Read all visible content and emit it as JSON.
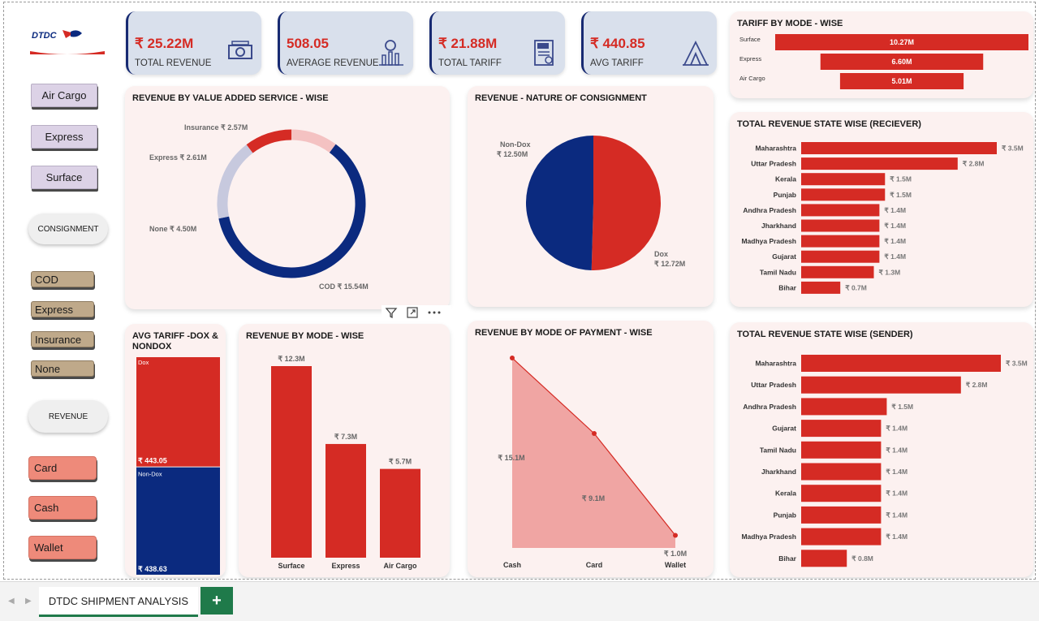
{
  "kpis": [
    {
      "value": "₹ 25.22M",
      "label": "TOTAL REVENUE",
      "icon": "money-icon"
    },
    {
      "value": "508.05",
      "label": "AVERAGE REVENUE",
      "icon": "growth-chart-icon"
    },
    {
      "value": "₹ 21.88M",
      "label": "TOTAL TARIFF",
      "icon": "tax-document-icon"
    },
    {
      "value": "₹ 440.85",
      "label": "AVG TARIFF",
      "icon": "tent-icon"
    }
  ],
  "logo": {
    "text": "DTDC"
  },
  "slicers": {
    "mode": [
      "Air Cargo",
      "Express",
      "Surface"
    ],
    "consignment_header": "CONSIGNMENT",
    "consignment": [
      "COD",
      "Express",
      "Insurance",
      "None"
    ],
    "revenue_header": "REVENUE",
    "payment": [
      "Card",
      "Cash",
      "Wallet"
    ]
  },
  "colors": {
    "red": "#d52b24",
    "navy": "#0b2a7f",
    "lightred": "#f0a5a3",
    "pink": "#f4c2c2",
    "grey": "#c7c9de"
  },
  "chart_data": [
    {
      "id": "tariff_mode",
      "type": "bar",
      "orientation": "horizontal",
      "title": "TARIFF BY MODE - WISE",
      "categories": [
        "Surface",
        "Express",
        "Air Cargo"
      ],
      "values": [
        10.27,
        6.6,
        5.01
      ],
      "labels": [
        "10.27M",
        "6.60M",
        "5.01M"
      ]
    },
    {
      "id": "vas_donut",
      "type": "pie",
      "style": "donut",
      "title": "REVENUE BY VALUE ADDED SERVICE - WISE",
      "categories": [
        "COD",
        "None",
        "Express",
        "Insurance"
      ],
      "values": [
        15.54,
        4.5,
        2.61,
        2.57
      ],
      "labels": [
        "COD ₹ 15.54M",
        "None ₹ 4.50M",
        "Express ₹ 2.61M",
        "Insurance ₹ 2.57M"
      ]
    },
    {
      "id": "consignment_pie",
      "type": "pie",
      "title": "REVENUE - NATURE OF CONSIGNMENT",
      "categories": [
        "Dox",
        "Non-Dox"
      ],
      "values": [
        12.72,
        12.5
      ],
      "value_labels": [
        "₹ 12.72M",
        "₹ 12.50M"
      ]
    },
    {
      "id": "receiver_states",
      "type": "bar",
      "orientation": "horizontal",
      "title": "TOTAL REVENUE STATE WISE (RECIEVER)",
      "categories": [
        "Maharashtra",
        "Uttar Pradesh",
        "Kerala",
        "Punjab",
        "Andhra Pradesh",
        "Jharkhand",
        "Madhya Pradesh",
        "Gujarat",
        "Tamil Nadu",
        "Bihar"
      ],
      "values": [
        3.5,
        2.8,
        1.5,
        1.5,
        1.4,
        1.4,
        1.4,
        1.4,
        1.3,
        0.7
      ],
      "labels": [
        "₹ 3.5M",
        "₹ 2.8M",
        "₹ 1.5M",
        "₹ 1.5M",
        "₹ 1.4M",
        "₹ 1.4M",
        "₹ 1.4M",
        "₹ 1.4M",
        "₹ 1.3M",
        "₹ 0.7M"
      ]
    },
    {
      "id": "avg_tariff_dox",
      "type": "bar",
      "style": "100% stacked",
      "title": "AVG TARIFF -DOX & NONDOX",
      "categories": [
        "Dox",
        "Non-Dox"
      ],
      "values": [
        443.05,
        438.63
      ],
      "labels": [
        "₹ 443.05",
        "₹ 438.63"
      ]
    },
    {
      "id": "revenue_mode",
      "type": "bar",
      "title": "REVENUE BY MODE - WISE",
      "categories": [
        "Surface",
        "Express",
        "Air Cargo"
      ],
      "values": [
        12.3,
        7.3,
        5.7
      ],
      "labels": [
        "₹ 12.3M",
        "₹ 7.3M",
        "₹ 5.7M"
      ]
    },
    {
      "id": "payment_area",
      "type": "area",
      "title": "REVENUE BY MODE OF PAYMENT - WISE",
      "categories": [
        "Cash",
        "Card",
        "Wallet"
      ],
      "values": [
        15.1,
        9.1,
        1.0
      ],
      "labels": [
        "₹ 15.1M",
        "₹ 9.1M",
        "₹ 1.0M"
      ]
    },
    {
      "id": "sender_states",
      "type": "bar",
      "orientation": "horizontal",
      "title": "TOTAL REVENUE STATE WISE (SENDER)",
      "categories": [
        "Maharashtra",
        "Uttar Pradesh",
        "Andhra Pradesh",
        "Gujarat",
        "Tamil Nadu",
        "Jharkhand",
        "Kerala",
        "Punjab",
        "Madhya Pradesh",
        "Bihar"
      ],
      "values": [
        3.5,
        2.8,
        1.5,
        1.4,
        1.4,
        1.4,
        1.4,
        1.4,
        1.4,
        0.8
      ],
      "labels": [
        "₹ 3.5M",
        "₹ 2.8M",
        "₹ 1.5M",
        "₹ 1.4M",
        "₹ 1.4M",
        "₹ 1.4M",
        "₹ 1.4M",
        "₹ 1.4M",
        "₹ 1.4M",
        "₹ 0.8M"
      ]
    }
  ],
  "tab": {
    "label": "DTDC SHIPMENT ANALYSIS",
    "add": "+"
  }
}
